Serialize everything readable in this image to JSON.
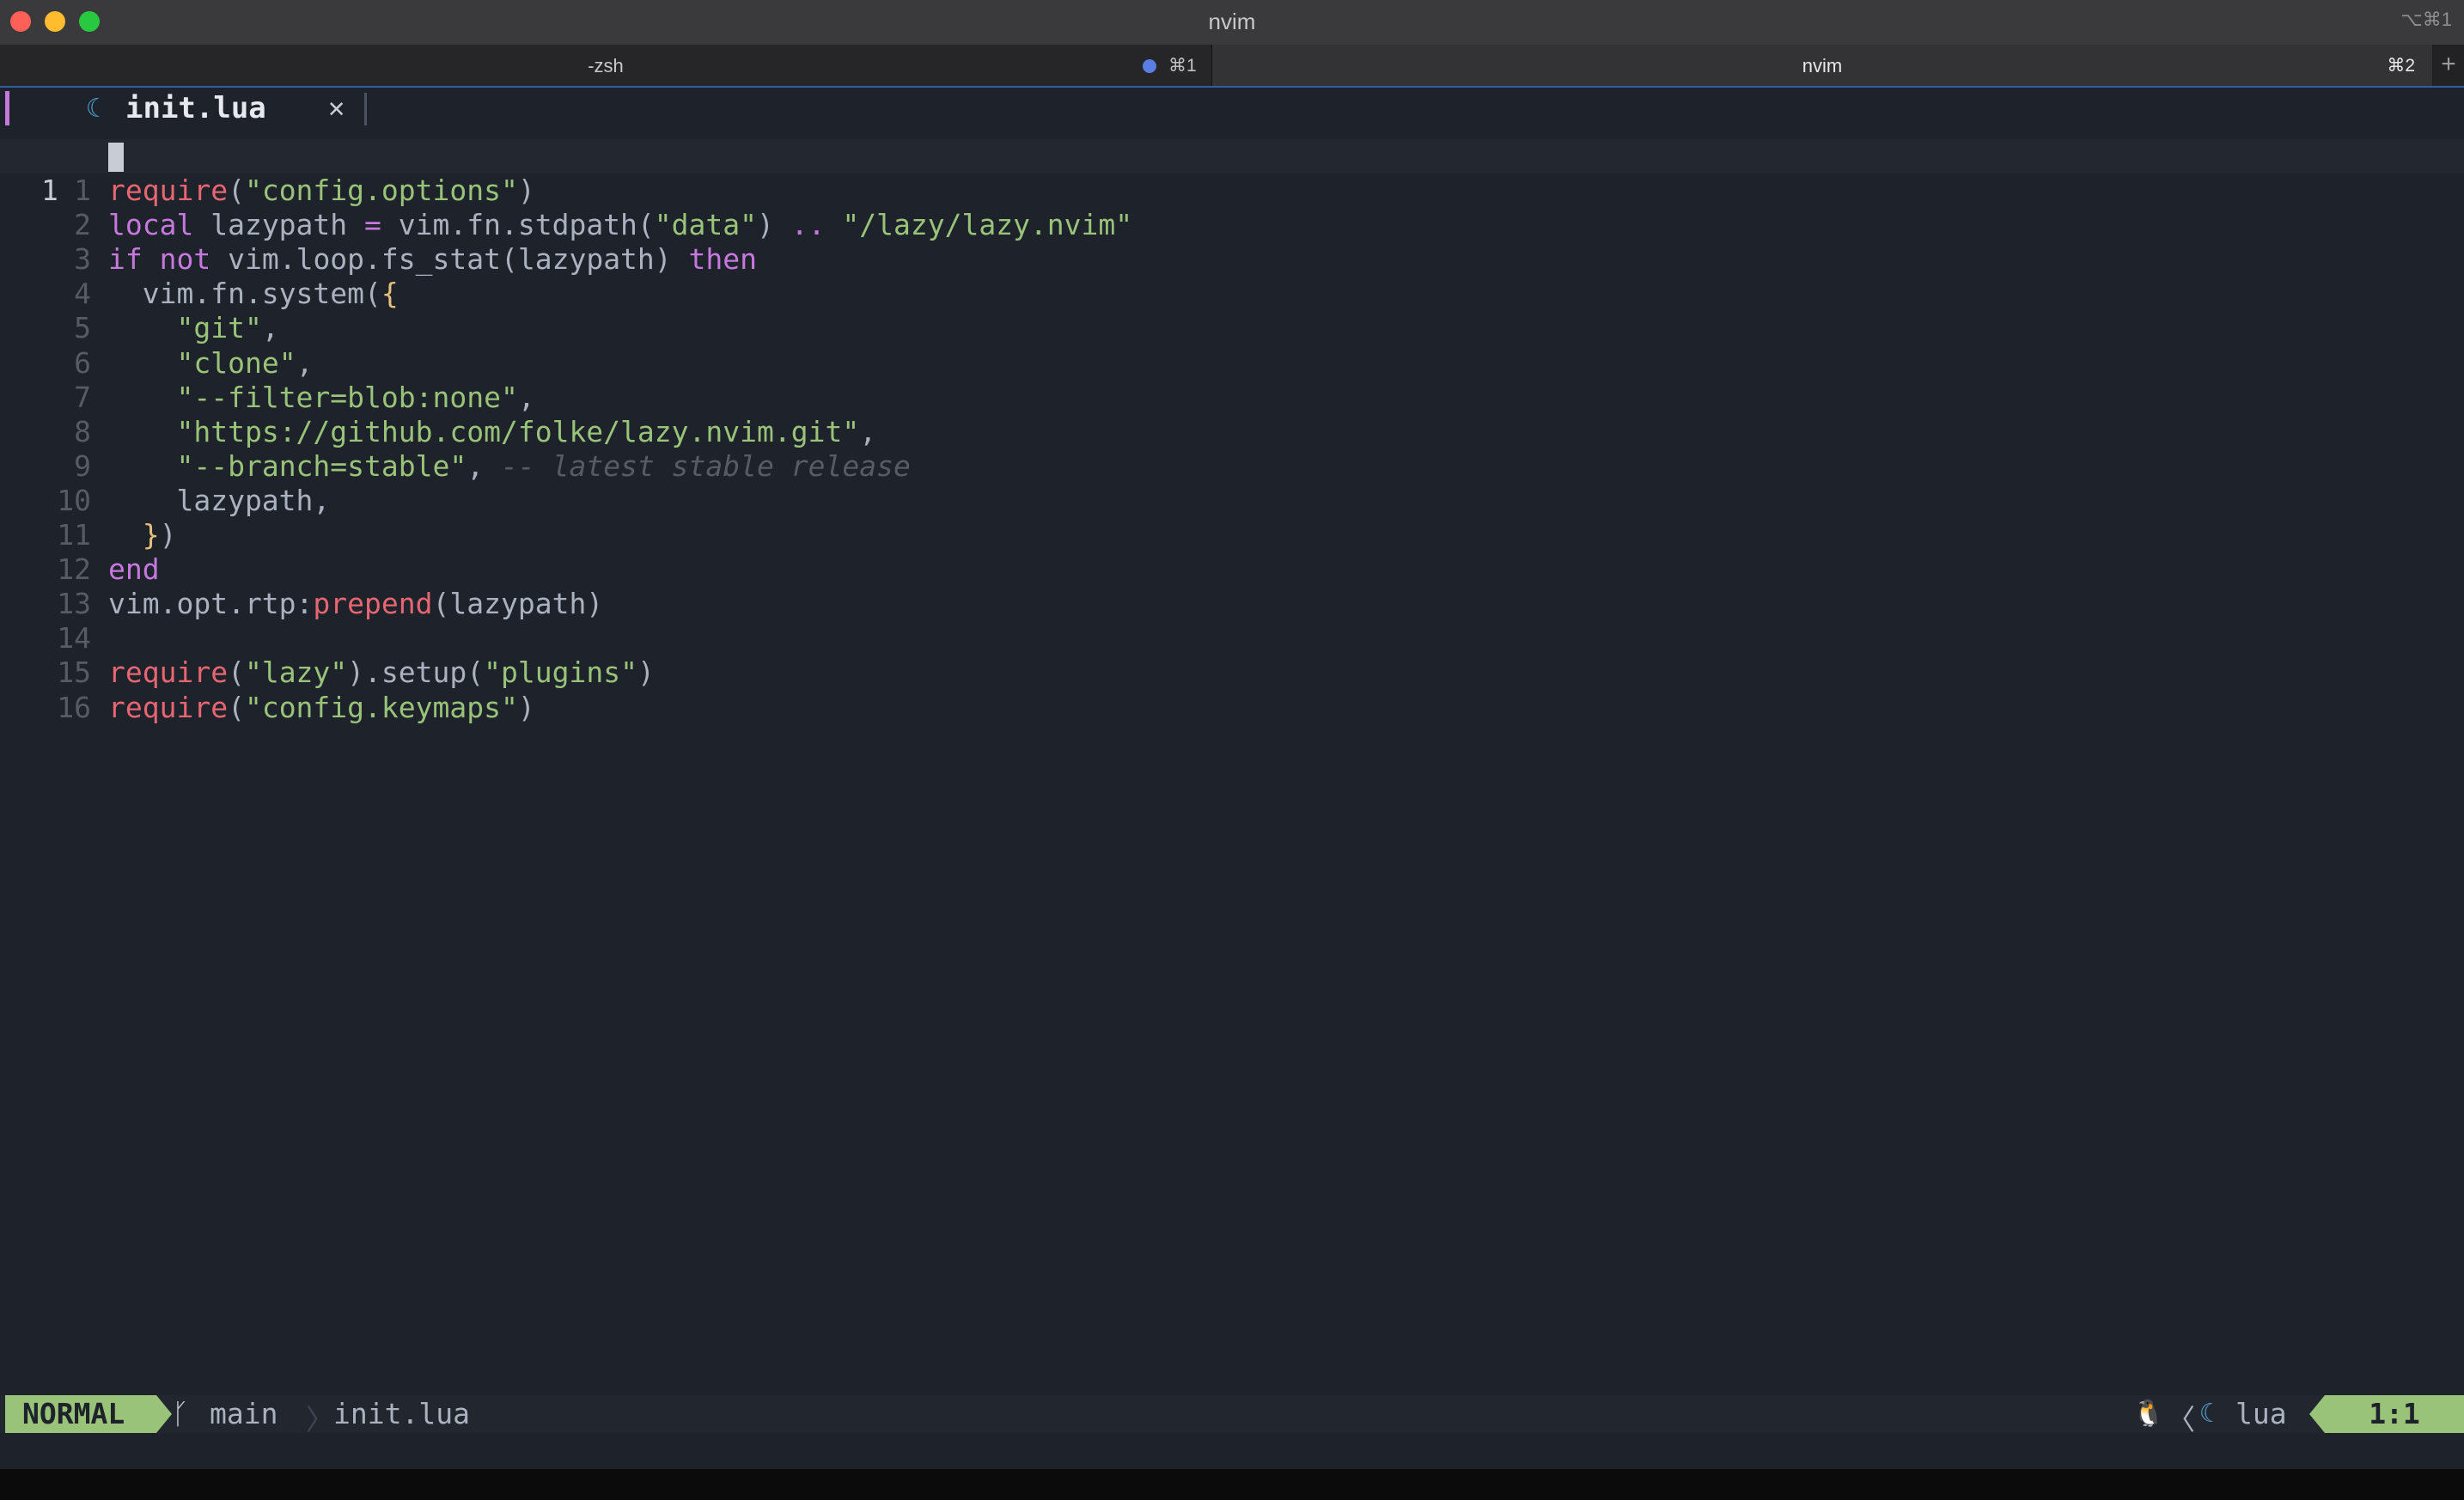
{
  "window": {
    "title": "nvim",
    "shortcut": "⌥⌘1"
  },
  "terminal_tabs": [
    {
      "label": "-zsh",
      "shortcut": "⌘1"
    },
    {
      "label": "nvim",
      "shortcut": "⌘2"
    }
  ],
  "new_tab_label": "+",
  "bufferline": {
    "file": "init.lua",
    "close": "✕"
  },
  "editor": {
    "current_line_number": "1",
    "lines": [
      {
        "n": "1",
        "tokens": [
          {
            "t": "req",
            "v": "require"
          },
          {
            "t": "plain",
            "v": "("
          },
          {
            "t": "str",
            "v": "\"config.options\""
          },
          {
            "t": "plain",
            "v": ")"
          }
        ]
      },
      {
        "n": "2",
        "tokens": [
          {
            "t": "kw",
            "v": "local"
          },
          {
            "t": "plain",
            "v": " lazypath "
          },
          {
            "t": "op",
            "v": "="
          },
          {
            "t": "plain",
            "v": " vim.fn.stdpath("
          },
          {
            "t": "str",
            "v": "\"data\""
          },
          {
            "t": "plain",
            "v": ") "
          },
          {
            "t": "op",
            "v": ".."
          },
          {
            "t": "plain",
            "v": " "
          },
          {
            "t": "str",
            "v": "\"/lazy/lazy.nvim\""
          }
        ]
      },
      {
        "n": "3",
        "tokens": [
          {
            "t": "kw",
            "v": "if"
          },
          {
            "t": "plain",
            "v": " "
          },
          {
            "t": "kw",
            "v": "not"
          },
          {
            "t": "plain",
            "v": " vim.loop.fs_stat(lazypath) "
          },
          {
            "t": "kw",
            "v": "then"
          }
        ]
      },
      {
        "n": "4",
        "tokens": [
          {
            "t": "plain",
            "v": "  vim.fn.system("
          },
          {
            "t": "br",
            "v": "{"
          }
        ]
      },
      {
        "n": "5",
        "tokens": [
          {
            "t": "plain",
            "v": "    "
          },
          {
            "t": "str",
            "v": "\"git\""
          },
          {
            "t": "plain",
            "v": ","
          }
        ]
      },
      {
        "n": "6",
        "tokens": [
          {
            "t": "plain",
            "v": "    "
          },
          {
            "t": "str",
            "v": "\"clone\""
          },
          {
            "t": "plain",
            "v": ","
          }
        ]
      },
      {
        "n": "7",
        "tokens": [
          {
            "t": "plain",
            "v": "    "
          },
          {
            "t": "str",
            "v": "\"--filter=blob:none\""
          },
          {
            "t": "plain",
            "v": ","
          }
        ]
      },
      {
        "n": "8",
        "tokens": [
          {
            "t": "plain",
            "v": "    "
          },
          {
            "t": "str",
            "v": "\"https://github.com/folke/lazy.nvim.git\""
          },
          {
            "t": "plain",
            "v": ","
          }
        ]
      },
      {
        "n": "9",
        "tokens": [
          {
            "t": "plain",
            "v": "    "
          },
          {
            "t": "str",
            "v": "\"--branch=stable\""
          },
          {
            "t": "plain",
            "v": ", "
          },
          {
            "t": "cmt",
            "v": "-- latest stable release"
          }
        ]
      },
      {
        "n": "10",
        "tokens": [
          {
            "t": "plain",
            "v": "    lazypath,"
          }
        ]
      },
      {
        "n": "11",
        "tokens": [
          {
            "t": "plain",
            "v": "  "
          },
          {
            "t": "br",
            "v": "}"
          },
          {
            "t": "plain",
            "v": ")"
          }
        ]
      },
      {
        "n": "12",
        "tokens": [
          {
            "t": "kw",
            "v": "end"
          }
        ]
      },
      {
        "n": "13",
        "tokens": [
          {
            "t": "plain",
            "v": "vim.opt.rtp:"
          },
          {
            "t": "req",
            "v": "prepend"
          },
          {
            "t": "plain",
            "v": "(lazypath)"
          }
        ]
      },
      {
        "n": "14",
        "tokens": []
      },
      {
        "n": "15",
        "tokens": [
          {
            "t": "req",
            "v": "require"
          },
          {
            "t": "plain",
            "v": "("
          },
          {
            "t": "str",
            "v": "\"lazy\""
          },
          {
            "t": "plain",
            "v": ").setup("
          },
          {
            "t": "str",
            "v": "\"plugins\""
          },
          {
            "t": "plain",
            "v": ")"
          }
        ]
      },
      {
        "n": "16",
        "tokens": [
          {
            "t": "req",
            "v": "require"
          },
          {
            "t": "plain",
            "v": "("
          },
          {
            "t": "str",
            "v": "\"config.keymaps\""
          },
          {
            "t": "plain",
            "v": ")"
          }
        ]
      }
    ]
  },
  "statusline": {
    "mode": "NORMAL",
    "branch_icon": "ᚴ",
    "branch": "main",
    "separator": "〉",
    "file": "init.lua",
    "os_icon": "🐧",
    "right_separator": "〈",
    "filetype_icon": "☾",
    "filetype": "lua",
    "position": "1:1"
  },
  "colors": {
    "background": "#1e222a",
    "accent_green": "#98c379",
    "keyword_purple": "#c678dd",
    "string_green": "#98c379",
    "require_red": "#e86671",
    "comment_gray": "#565c64",
    "lua_blue": "#51a0cf"
  }
}
